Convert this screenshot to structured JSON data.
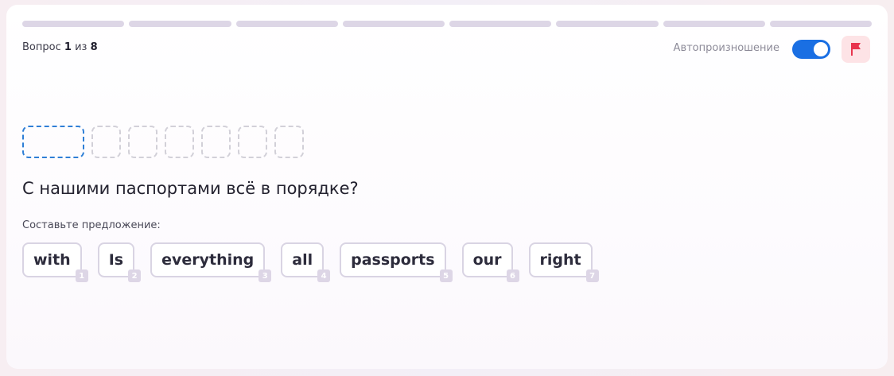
{
  "progress": {
    "total": 8,
    "current": 1
  },
  "header": {
    "counter_prefix": "Вопрос",
    "counter_current": "1",
    "counter_middle": "из",
    "counter_total": "8",
    "auto_pronounce_label": "Автопроизношение",
    "auto_pronounce_on": true,
    "flag_icon": "flag-icon"
  },
  "answer": {
    "slot_count": 7
  },
  "question": {
    "text": "С нашими паспортами всё в порядке?"
  },
  "instruction": "Составьте предложение:",
  "words": [
    {
      "label": "with",
      "num": "1"
    },
    {
      "label": "Is",
      "num": "2"
    },
    {
      "label": "everything",
      "num": "3"
    },
    {
      "label": "all",
      "num": "4"
    },
    {
      "label": "passports",
      "num": "5"
    },
    {
      "label": "our",
      "num": "6"
    },
    {
      "label": "right",
      "num": "7"
    }
  ],
  "colors": {
    "accent": "#1a6fe3",
    "flag": "#e8344e",
    "flag_bg": "#fde3e6",
    "progress_track": "#ddd6e6"
  }
}
